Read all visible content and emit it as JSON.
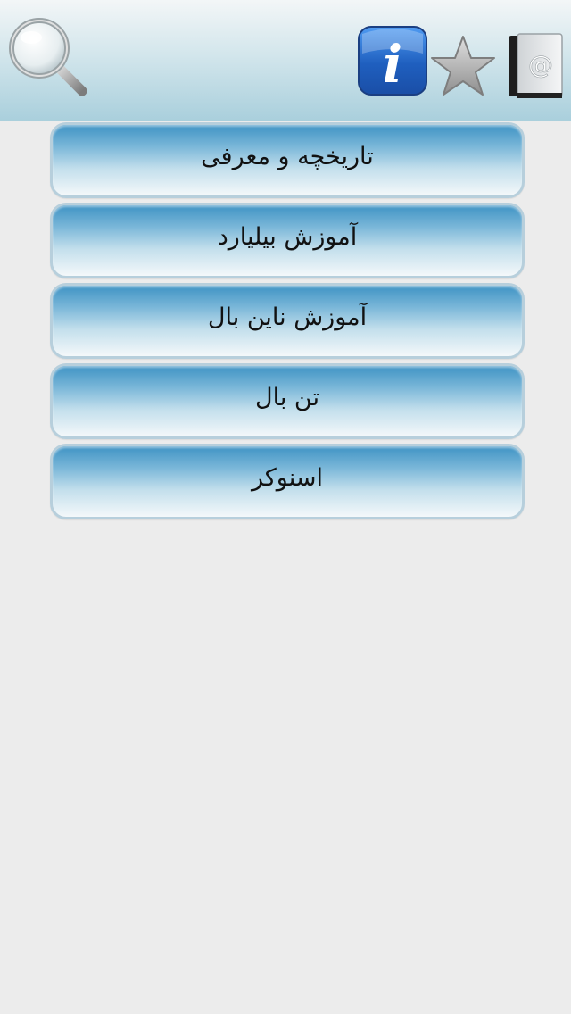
{
  "toolbar": {
    "icons": [
      {
        "name": "search-icon",
        "position": "left"
      },
      {
        "name": "info-icon",
        "position": "right"
      },
      {
        "name": "star-icon",
        "position": "right"
      },
      {
        "name": "contacts-book-icon",
        "position": "right"
      }
    ],
    "contacts_glyph": "@",
    "info_glyph": "i",
    "colors": {
      "bar_top": "#f3f6f7",
      "bar_bottom": "#a9cfdc",
      "info_blue": "#1f5fbf",
      "star_gray": "#a9a9a9"
    }
  },
  "menu": {
    "items": [
      {
        "label": "تاریخچه و معرفی"
      },
      {
        "label": "آموزش بیلیارد"
      },
      {
        "label": "آموزش ناین بال"
      },
      {
        "label": "تن بال"
      },
      {
        "label": "اسنوکر"
      }
    ],
    "colors": {
      "button_top": "#3f93c4",
      "button_bottom": "#f4f8fa",
      "border": "#b7cfdc"
    }
  },
  "page": {
    "background": "#ececec"
  }
}
